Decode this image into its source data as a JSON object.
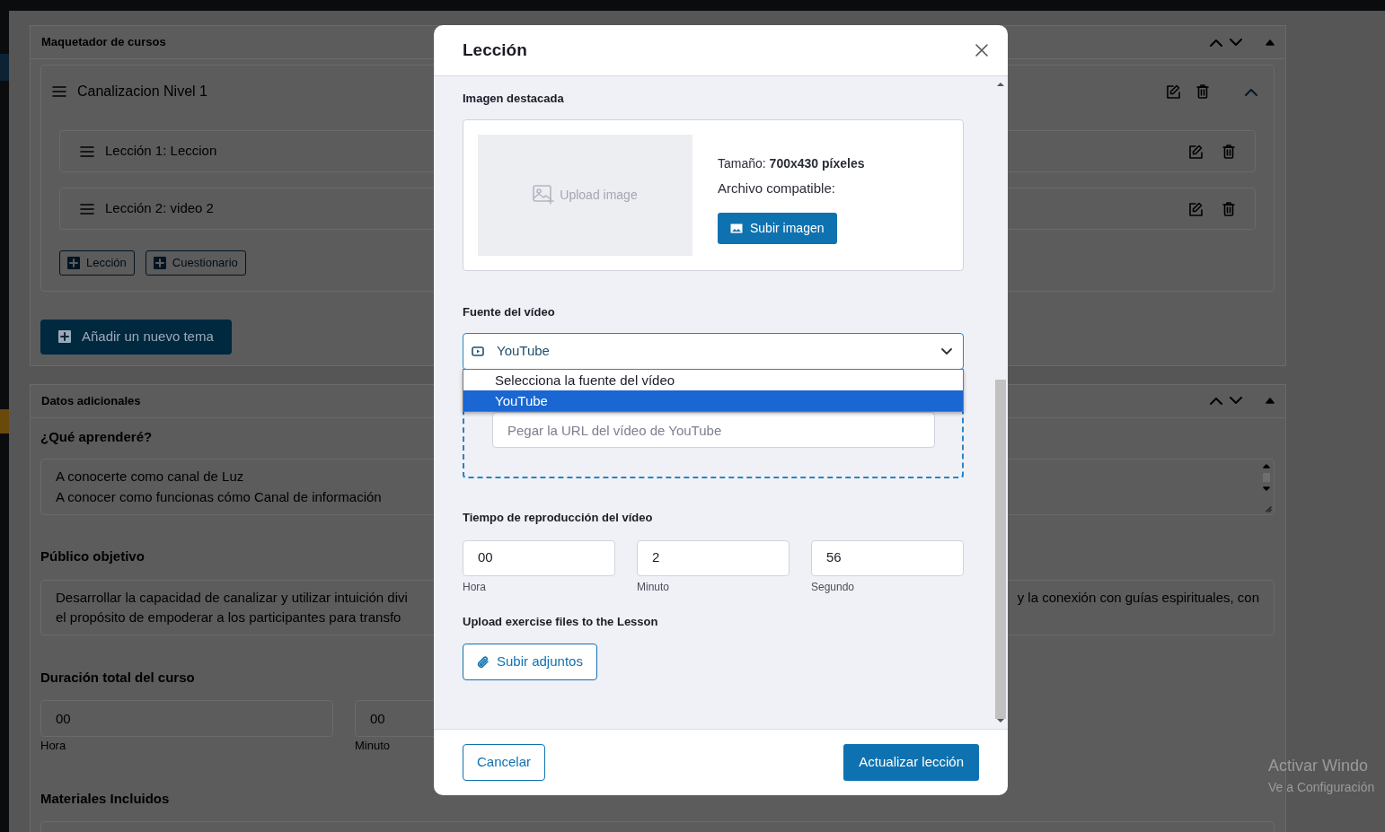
{
  "course_builder": {
    "title": "Maquetador de cursos",
    "topics": [
      {
        "title": "Canalizacion Nivel 1",
        "expanded": true,
        "lessons": [
          {
            "title": "Lección 1: Leccion"
          },
          {
            "title": "Lección 2: video 2"
          }
        ],
        "add_buttons": [
          "Lección",
          "Cuestionario"
        ]
      }
    ],
    "add_topic_button": "Añadir un nuevo tema"
  },
  "additional_data": {
    "title": "Datos adicionales",
    "what_learn": {
      "label": "¿Qué aprenderé?",
      "lines": [
        "A conocerte como canal de Luz",
        "A conocer como funcionas cómo Canal de información"
      ]
    },
    "audience": {
      "label": "Público objetivo",
      "left_lines": [
        "Desarrollar la capacidad de canalizar y utilizar intuición divi",
        "el propósito de empoderar a los participantes para transfo"
      ],
      "right_lines": [
        "y la conexión con guías espirituales, con"
      ]
    },
    "duration": {
      "label": "Duración total del curso",
      "fields": [
        {
          "value": "00",
          "caption": "Hora"
        },
        {
          "value": "00",
          "caption": "Minuto"
        }
      ]
    },
    "materials": {
      "label": "Materiales Incluidos"
    }
  },
  "modal": {
    "title": "Lección",
    "featured_image": {
      "label": "Imagen destacada",
      "upload_text": "Upload image",
      "size": "Tamaño: **700x430 píxeles**",
      "compatible": "Archivo compatible:",
      "button": "Subir imagen"
    },
    "video_source": {
      "label": "Fuente del vídeo",
      "value": "YouTube",
      "options": [
        {
          "label": "Selecciona la fuente del vídeo",
          "selected": false
        },
        {
          "label": "YouTube",
          "selected": true
        }
      ],
      "url_placeholder": "Pegar la URL del vídeo de YouTube"
    },
    "playback": {
      "label": "Tiempo de reproducción del vídeo",
      "fields": [
        {
          "value": "00",
          "caption": "Hora"
        },
        {
          "value": "2",
          "caption": "Minuto"
        },
        {
          "value": "56",
          "caption": "Segundo"
        }
      ]
    },
    "attachments": {
      "label": "Upload exercise files to the Lesson",
      "button": "Subir adjuntos"
    },
    "footer": {
      "cancel": "Cancelar",
      "submit": "Actualizar lección"
    }
  },
  "os_notice": [
    "Activar Windo",
    "Ve a Configuración"
  ]
}
